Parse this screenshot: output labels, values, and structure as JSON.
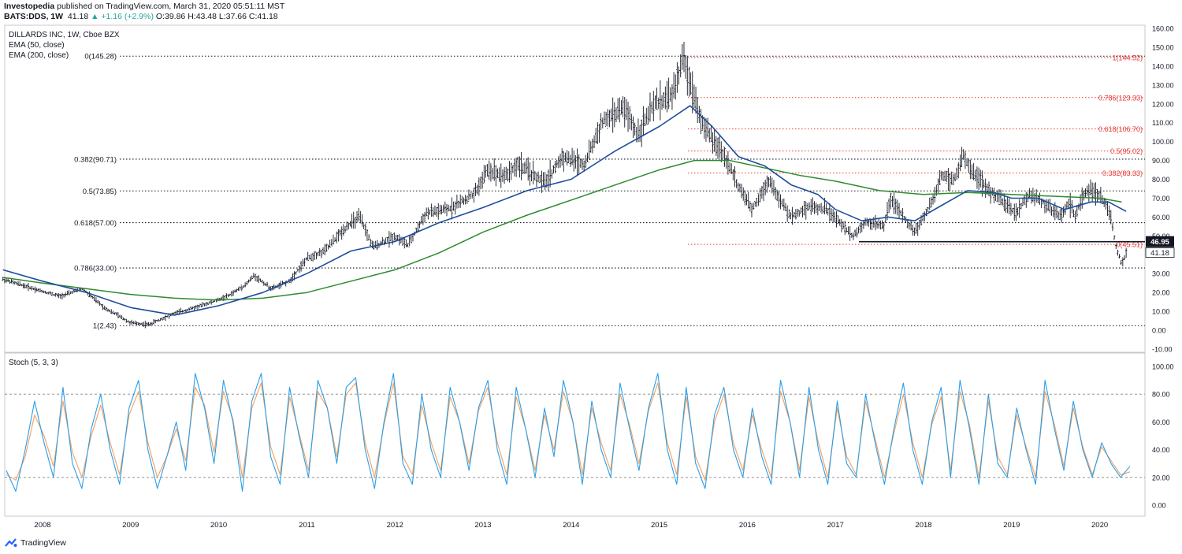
{
  "header": {
    "publisher": "Investopedia",
    "published_text": "published on TradingView.com, March 31, 2020 05:51:11 MST",
    "symbol": "BATS:DDS, 1W",
    "last": "41.18",
    "change": "▲ +1.16 (+2.9%)",
    "ohlc_o": "O:39.86",
    "ohlc_h": "H:43.48",
    "ohlc_l": "L:37.66",
    "ohlc_c": "C:41.18"
  },
  "legend": {
    "title": "DILLARDS INC, 1W, Cboe BZX",
    "ema50": "EMA (50, close)",
    "ema200": "EMA (200, close)",
    "stoch": "Stoch (5, 3, 3)"
  },
  "footer": {
    "brand": "TradingView"
  },
  "colors": {
    "ema50": "#1f4e9c",
    "ema200": "#2e8b2e",
    "stoch_k": "#2a9ee8",
    "stoch_d": "#f0a060",
    "fib_red": "#e53935",
    "price_bar": "#131722"
  },
  "chart_data": [
    {
      "type": "line",
      "title": "DILLARDS INC, 1W, Cboe BZX",
      "x_axis_labels": [
        "2008",
        "2009",
        "2010",
        "2011",
        "2012",
        "2013",
        "2014",
        "2015",
        "2016",
        "2017",
        "2018",
        "2019",
        "2020"
      ],
      "x_range": [
        2007.55,
        2020.4
      ],
      "y_ticks": [
        "160.00",
        "150.00",
        "140.00",
        "130.00",
        "120.00",
        "110.00",
        "100.00",
        "90.00",
        "80.00",
        "70.00",
        "60.00",
        "50.00",
        "40.00",
        "30.00",
        "20.00",
        "10.00",
        "0.00",
        "-10.00"
      ],
      "ylim": [
        -10,
        160
      ],
      "series": [
        {
          "name": "DDS",
          "style": "weekly-ohlc-bars",
          "points": [
            [
              2007.55,
              27
            ],
            [
              2007.9,
              22
            ],
            [
              2008.2,
              18
            ],
            [
              2008.45,
              22
            ],
            [
              2008.7,
              12
            ],
            [
              2008.85,
              8
            ],
            [
              2009.0,
              4
            ],
            [
              2009.2,
              3
            ],
            [
              2009.5,
              9
            ],
            [
              2009.8,
              13
            ],
            [
              2010.1,
              18
            ],
            [
              2010.3,
              24
            ],
            [
              2010.4,
              29
            ],
            [
              2010.6,
              22
            ],
            [
              2010.8,
              26
            ],
            [
              2011.0,
              38
            ],
            [
              2011.2,
              42
            ],
            [
              2011.45,
              55
            ],
            [
              2011.6,
              60
            ],
            [
              2011.75,
              44
            ],
            [
              2012.0,
              50
            ],
            [
              2012.15,
              45
            ],
            [
              2012.35,
              62
            ],
            [
              2012.6,
              64
            ],
            [
              2012.9,
              72
            ],
            [
              2013.05,
              85
            ],
            [
              2013.25,
              82
            ],
            [
              2013.4,
              88
            ],
            [
              2013.7,
              78
            ],
            [
              2013.9,
              92
            ],
            [
              2014.15,
              88
            ],
            [
              2014.35,
              110
            ],
            [
              2014.6,
              118
            ],
            [
              2014.75,
              104
            ],
            [
              2014.95,
              120
            ],
            [
              2015.15,
              125
            ],
            [
              2015.27,
              144
            ],
            [
              2015.35,
              132
            ],
            [
              2015.5,
              108
            ],
            [
              2015.75,
              92
            ],
            [
              2015.9,
              76
            ],
            [
              2016.05,
              64
            ],
            [
              2016.25,
              80
            ],
            [
              2016.35,
              70
            ],
            [
              2016.5,
              60
            ],
            [
              2016.7,
              66
            ],
            [
              2016.9,
              64
            ],
            [
              2017.05,
              57
            ],
            [
              2017.2,
              50
            ],
            [
              2017.35,
              58
            ],
            [
              2017.55,
              55
            ],
            [
              2017.62,
              70
            ],
            [
              2017.8,
              58
            ],
            [
              2017.9,
              52
            ],
            [
              2018.1,
              68
            ],
            [
              2018.2,
              82
            ],
            [
              2018.35,
              80
            ],
            [
              2018.45,
              92
            ],
            [
              2018.55,
              85
            ],
            [
              2018.7,
              76
            ],
            [
              2018.9,
              68
            ],
            [
              2019.05,
              62
            ],
            [
              2019.2,
              72
            ],
            [
              2019.35,
              68
            ],
            [
              2019.55,
              60
            ],
            [
              2019.65,
              68
            ],
            [
              2019.72,
              60
            ],
            [
              2019.85,
              75
            ],
            [
              2020.0,
              72
            ],
            [
              2020.12,
              62
            ],
            [
              2020.18,
              45
            ],
            [
              2020.25,
              35
            ],
            [
              2020.3,
              41.18
            ]
          ]
        },
        {
          "name": "EMA (50, close)",
          "points": [
            [
              2007.55,
              32
            ],
            [
              2008.0,
              26
            ],
            [
              2008.5,
              20
            ],
            [
              2009.0,
              12
            ],
            [
              2009.5,
              8
            ],
            [
              2010.0,
              13
            ],
            [
              2010.5,
              20
            ],
            [
              2011.0,
              30
            ],
            [
              2011.5,
              42
            ],
            [
              2012.0,
              47
            ],
            [
              2012.5,
              57
            ],
            [
              2013.0,
              65
            ],
            [
              2013.5,
              74
            ],
            [
              2014.0,
              80
            ],
            [
              2014.5,
              95
            ],
            [
              2015.0,
              108
            ],
            [
              2015.35,
              119
            ],
            [
              2015.6,
              108
            ],
            [
              2015.9,
              92
            ],
            [
              2016.2,
              87
            ],
            [
              2016.5,
              77
            ],
            [
              2016.8,
              72
            ],
            [
              2017.0,
              64
            ],
            [
              2017.3,
              58
            ],
            [
              2017.6,
              60
            ],
            [
              2017.9,
              58
            ],
            [
              2018.2,
              66
            ],
            [
              2018.5,
              74
            ],
            [
              2018.8,
              73
            ],
            [
              2019.0,
              70
            ],
            [
              2019.3,
              70
            ],
            [
              2019.6,
              64
            ],
            [
              2019.9,
              68
            ],
            [
              2020.1,
              68
            ],
            [
              2020.3,
              63
            ]
          ]
        },
        {
          "name": "EMA (200, close)",
          "points": [
            [
              2007.55,
              28
            ],
            [
              2008.0,
              25
            ],
            [
              2008.5,
              22
            ],
            [
              2009.0,
              19
            ],
            [
              2009.5,
              17
            ],
            [
              2010.0,
              16
            ],
            [
              2010.5,
              17
            ],
            [
              2011.0,
              20
            ],
            [
              2011.5,
              26
            ],
            [
              2012.0,
              32
            ],
            [
              2012.5,
              41
            ],
            [
              2013.0,
              52
            ],
            [
              2013.5,
              61
            ],
            [
              2014.0,
              69
            ],
            [
              2014.5,
              77
            ],
            [
              2015.0,
              85
            ],
            [
              2015.4,
              90
            ],
            [
              2015.8,
              90
            ],
            [
              2016.2,
              86
            ],
            [
              2016.6,
              82
            ],
            [
              2017.0,
              79
            ],
            [
              2017.5,
              74
            ],
            [
              2018.0,
              72
            ],
            [
              2018.5,
              73
            ],
            [
              2019.0,
              72
            ],
            [
              2019.5,
              71
            ],
            [
              2020.0,
              70
            ],
            [
              2020.25,
              68
            ]
          ]
        }
      ],
      "fibonacci_left": [
        {
          "label": "0(145.28)",
          "value": 145.28
        },
        {
          "label": "0.382(90.71)",
          "value": 90.71
        },
        {
          "label": "0.5(73.85)",
          "value": 73.85
        },
        {
          "label": "0.618(57.00)",
          "value": 57.0
        },
        {
          "label": "0.786(33.00)",
          "value": 33.0
        },
        {
          "label": "1(2.43)",
          "value": 2.43
        }
      ],
      "fibonacci_right": [
        {
          "label": "1(144.52)",
          "value": 144.52
        },
        {
          "label": "0.786(123.33)",
          "value": 123.33
        },
        {
          "label": "0.618(106.70)",
          "value": 106.7
        },
        {
          "label": "0.5(95.02)",
          "value": 95.02
        },
        {
          "label": "0.382(83.33)",
          "value": 83.33
        },
        {
          "label": "0(45.51)",
          "value": 45.51
        }
      ],
      "horizontal_line": {
        "value": 46.95,
        "label": "46.95"
      },
      "last_price": {
        "value": 41.18,
        "label": "41.18"
      }
    },
    {
      "type": "line",
      "title": "Stoch (5, 3, 3)",
      "y_ticks": [
        "100.00",
        "80.00",
        "60.00",
        "40.00",
        "20.00",
        "0.00"
      ],
      "ylim": [
        -10,
        105
      ],
      "bands": [
        80,
        20
      ],
      "series": [
        {
          "name": "%K",
          "values": [
            25,
            10,
            40,
            75,
            45,
            20,
            85,
            30,
            12,
            55,
            80,
            40,
            15,
            70,
            90,
            40,
            12,
            35,
            60,
            25,
            95,
            70,
            30,
            90,
            60,
            10,
            75,
            95,
            35,
            15,
            85,
            50,
            20,
            90,
            70,
            30,
            85,
            92,
            40,
            12,
            60,
            95,
            30,
            15,
            80,
            40,
            20,
            85,
            60,
            25,
            70,
            90,
            40,
            15,
            85,
            55,
            20,
            70,
            35,
            90,
            60,
            15,
            75,
            40,
            20,
            88,
            55,
            25,
            70,
            95,
            40,
            15,
            85,
            30,
            12,
            65,
            85,
            40,
            20,
            70,
            35,
            15,
            90,
            60,
            20,
            85,
            40,
            15,
            75,
            30,
            20,
            80,
            45,
            15,
            55,
            88,
            40,
            15,
            60,
            85,
            20,
            90,
            55,
            15,
            80,
            30,
            20,
            70,
            40,
            15,
            90,
            55,
            25,
            75,
            40,
            20,
            45,
            30,
            20,
            28
          ]
        },
        {
          "name": "%D",
          "values": [
            22,
            18,
            35,
            65,
            50,
            28,
            75,
            38,
            20,
            50,
            72,
            45,
            22,
            65,
            82,
            45,
            20,
            35,
            55,
            32,
            85,
            72,
            38,
            82,
            62,
            20,
            70,
            88,
            42,
            22,
            78,
            52,
            25,
            82,
            70,
            35,
            80,
            88,
            45,
            20,
            58,
            88,
            35,
            22,
            72,
            45,
            25,
            78,
            60,
            30,
            68,
            85,
            45,
            22,
            78,
            55,
            25,
            65,
            40,
            82,
            60,
            22,
            70,
            45,
            25,
            80,
            58,
            30,
            68,
            88,
            45,
            22,
            78,
            35,
            18,
            60,
            80,
            45,
            25,
            65,
            40,
            20,
            82,
            60,
            25,
            78,
            45,
            20,
            70,
            35,
            22,
            75,
            48,
            20,
            52,
            80,
            45,
            20,
            58,
            78,
            25,
            82,
            58,
            20,
            75,
            35,
            22,
            65,
            42,
            20,
            82,
            58,
            28,
            70,
            42,
            22,
            42,
            32,
            22,
            24
          ]
        }
      ]
    }
  ]
}
